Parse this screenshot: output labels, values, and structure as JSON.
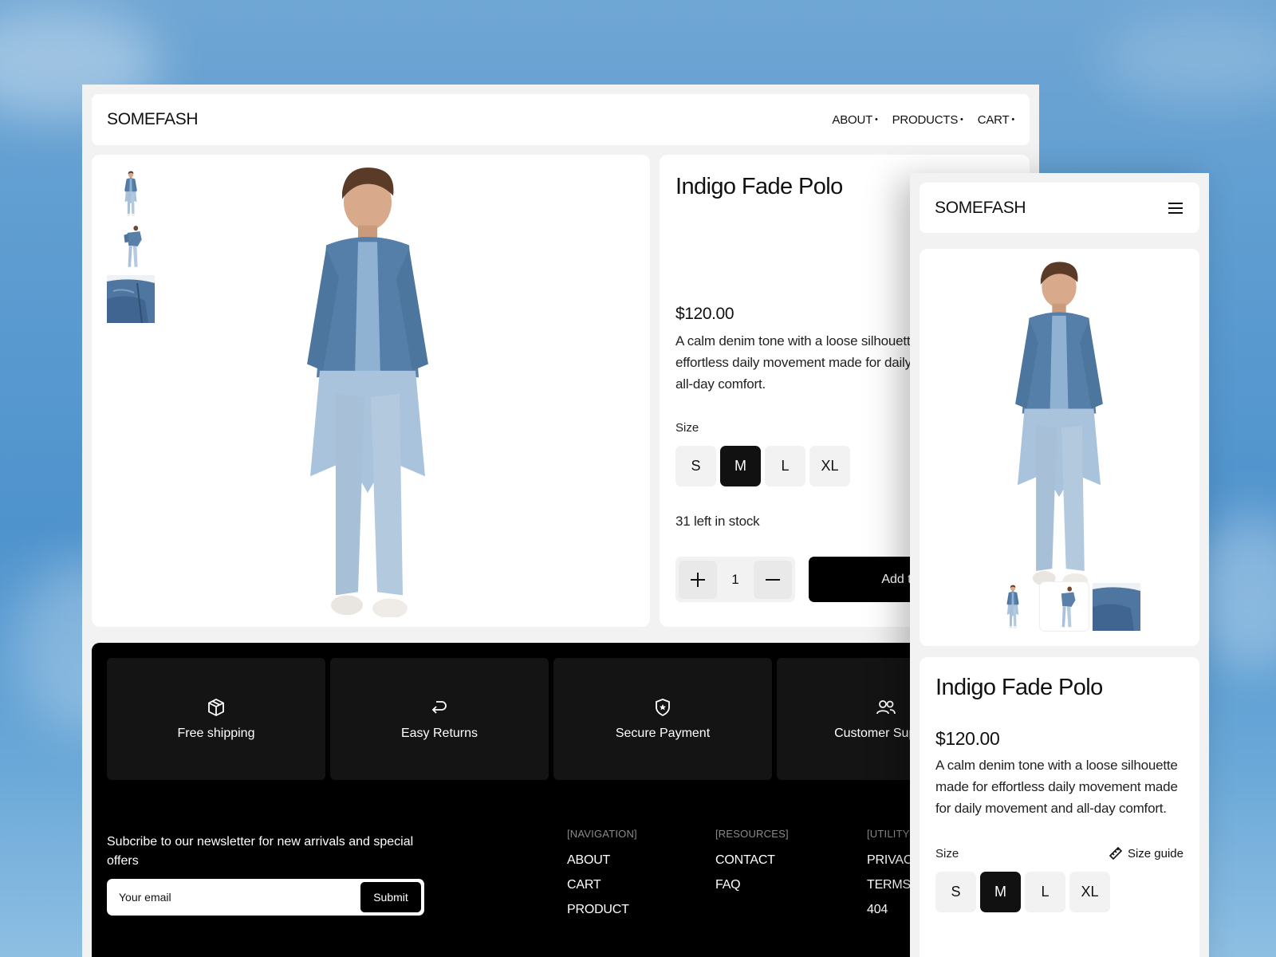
{
  "brand": "SOMEFASH",
  "nav": [
    {
      "label": "ABOUT"
    },
    {
      "label": "PRODUCTS"
    },
    {
      "label": "CART"
    }
  ],
  "product": {
    "title": "Indigo Fade Polo",
    "price": "$120.00",
    "description_desktop": "A calm denim tone with a loose silhouette made for effortless daily movement made for daily movement and all-day comfort.",
    "description_mobile": "A calm denim tone with a loose silhouette made for effortless daily movement made for daily movement and all-day comfort.",
    "size_label": "Size",
    "sizes": [
      "S",
      "M",
      "L",
      "XL"
    ],
    "selected_size": "M",
    "stock_text": "31 left in stock",
    "quantity": "1",
    "add_to_cart_label": "Add to cart",
    "size_guide_label": "Size guide"
  },
  "features": [
    {
      "label": "Free shipping",
      "icon": "box-icon"
    },
    {
      "label": "Easy Returns",
      "icon": "return-arrow-icon"
    },
    {
      "label": "Secure Payment",
      "icon": "shield-star-icon"
    },
    {
      "label": "Customer Support",
      "icon": "users-icon"
    }
  ],
  "newsletter": {
    "text": "Subcribe to our newsletter for new arrivals and special offers",
    "placeholder": "Your email",
    "submit_label": "Submit"
  },
  "footer_columns": [
    {
      "heading": "[NAVIGATION]",
      "links": [
        "ABOUT",
        "CART",
        "PRODUCT"
      ]
    },
    {
      "heading": "[RESOURCES]",
      "links": [
        "CONTACT",
        "FAQ"
      ]
    },
    {
      "heading": "[UTILITY]",
      "links": [
        "PRIVACY",
        "TERMS",
        "404"
      ]
    }
  ],
  "colors": {
    "accent": "#000000",
    "panel": "#ffffff",
    "page_bg": "#f2f2f2",
    "feature_card": "#141414",
    "denim": "#5f86b0"
  }
}
